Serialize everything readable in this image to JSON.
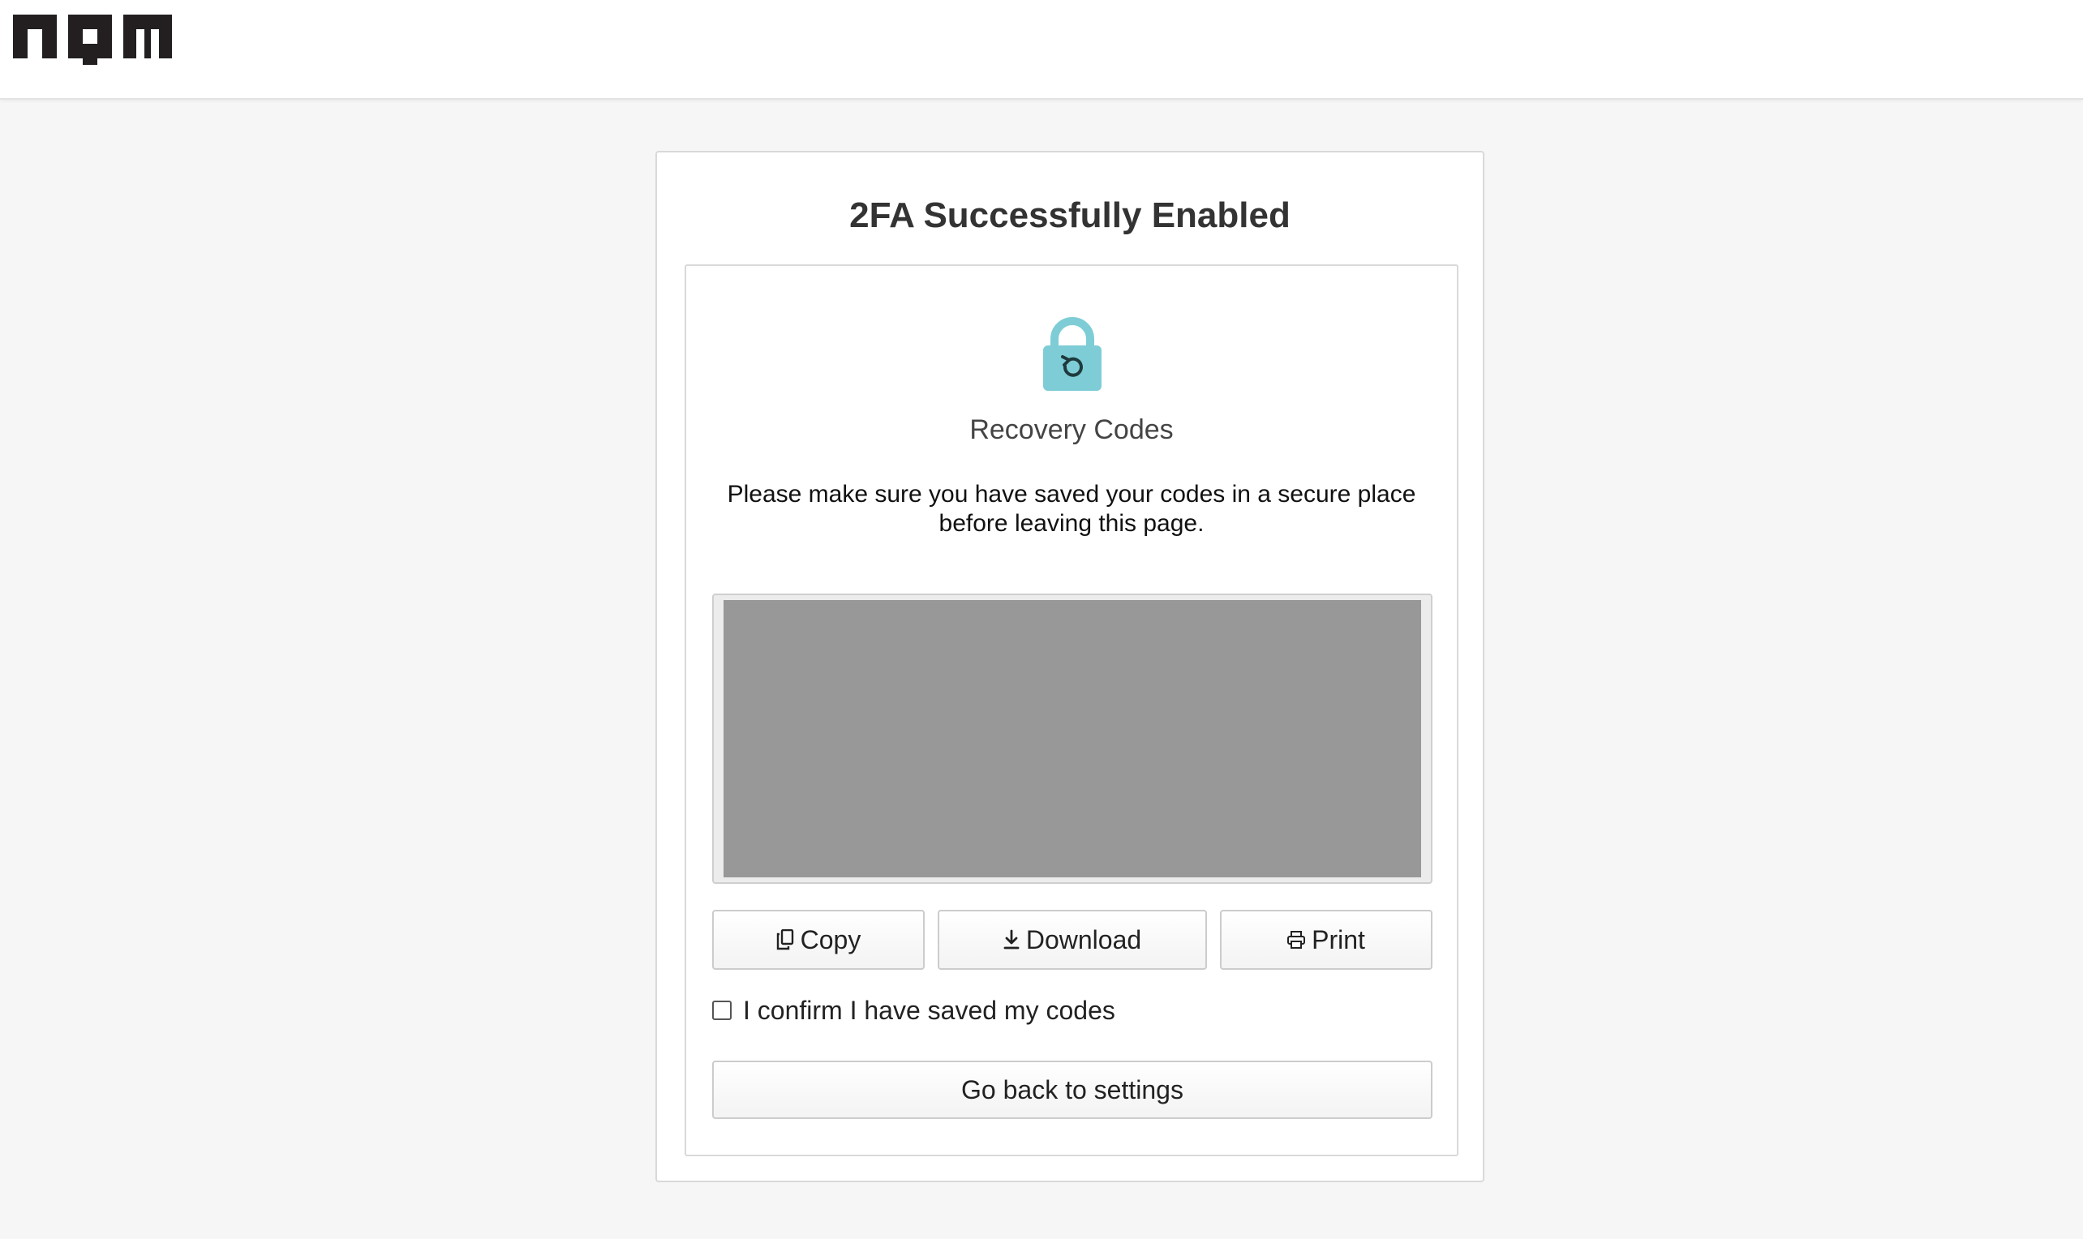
{
  "header": {
    "logo_text": "npm"
  },
  "card": {
    "title": "2FA Successfully Enabled",
    "section_title": "Recovery Codes",
    "description": "Please make sure you have saved your codes in a secure place before leaving this page.",
    "codes_redacted": true,
    "buttons": {
      "copy_label": "Copy",
      "download_label": "Download",
      "print_label": "Print"
    },
    "confirm_label": "I confirm I have saved my codes",
    "confirm_checked": false,
    "back_label": "Go back to settings"
  },
  "icons": {
    "logo": "npm-logo",
    "lock": "lock-refresh-icon",
    "copy": "copy-icon",
    "download": "download-icon",
    "print": "print-icon"
  },
  "colors": {
    "page_background": "#f6f6f6",
    "lock_body": "#7ecdd6",
    "codes_redaction": "#989898",
    "title_text": "#333333"
  }
}
